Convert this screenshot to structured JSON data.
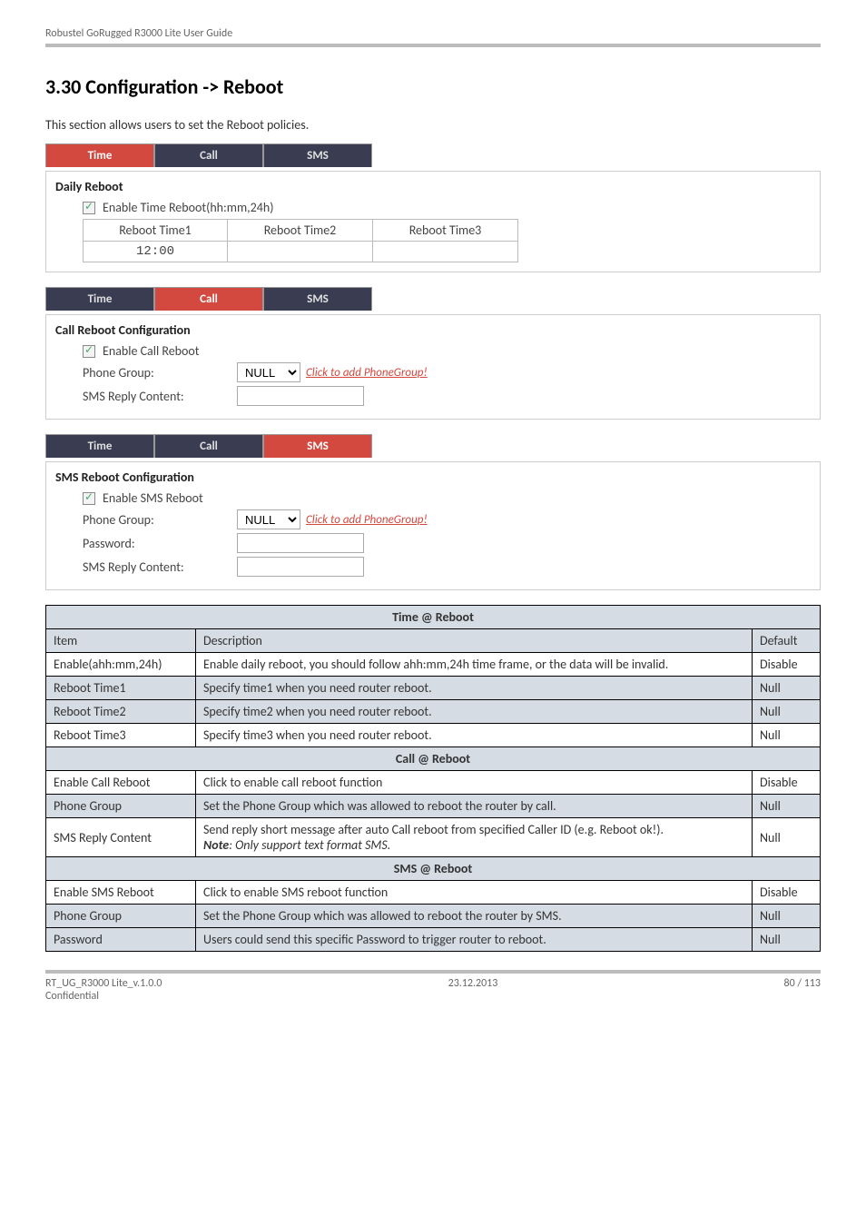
{
  "header": "Robustel GoRugged R3000 Lite User Guide",
  "heading": "3.30  Configuration -> Reboot",
  "intro": "This section allows users to set the Reboot policies.",
  "tabs": {
    "time": "Time",
    "call": "Call",
    "sms": "SMS"
  },
  "daily": {
    "title": "Daily Reboot",
    "enable_label": "Enable Time Reboot(hh:mm,24h)",
    "cols": {
      "t1": "Reboot Time1",
      "t2": "Reboot Time2",
      "t3": "Reboot Time3"
    },
    "vals": {
      "t1": "12:00",
      "t2": "",
      "t3": ""
    }
  },
  "call_cfg": {
    "title": "Call Reboot Configuration",
    "enable_label": "Enable Call Reboot",
    "phone_group_label": "Phone Group:",
    "phone_group_value": "NULL",
    "phone_group_link": "Click to add PhoneGroup!",
    "reply_label": "SMS Reply Content:"
  },
  "sms_cfg": {
    "title": "SMS Reboot Configuration",
    "enable_label": "Enable SMS Reboot",
    "phone_group_label": "Phone Group:",
    "phone_group_value": "NULL",
    "phone_group_link": "Click to add PhoneGroup!",
    "password_label": "Password:",
    "reply_label": "SMS Reply Content:"
  },
  "desc": {
    "time_hdr": "Time @ Reboot",
    "item_hdr": "Item",
    "desc_hdr": "Description",
    "def_hdr": "Default",
    "rows_time": [
      {
        "item": "Enable(ahh:mm,24h)",
        "desc": "Enable daily reboot, you should follow ahh:mm,24h time frame, or the data will be invalid.",
        "def": "Disable"
      },
      {
        "item": "Reboot Time1",
        "desc": "Specify time1 when you need router reboot.",
        "def": "Null"
      },
      {
        "item": "Reboot Time2",
        "desc": "Specify time2 when you need router reboot.",
        "def": "Null"
      },
      {
        "item": "Reboot Time3",
        "desc": "Specify time3 when you need router reboot.",
        "def": "Null"
      }
    ],
    "call_hdr": "Call @ Reboot",
    "rows_call": [
      {
        "item": "Enable Call Reboot",
        "desc": "Click to enable call reboot function",
        "def": "Disable"
      },
      {
        "item": "Phone Group",
        "desc": "Set the Phone Group which was allowed to reboot the router by call.",
        "def": "Null"
      }
    ],
    "sms_reply": {
      "item": "SMS Reply Content",
      "line1": "Send reply short message after auto Call reboot from specified Caller ID (e.g. Reboot ok!).",
      "note_label": "Note",
      "note_rest": ": Only support text format SMS.",
      "def": "Null"
    },
    "sms_hdr": "SMS @ Reboot",
    "rows_sms": [
      {
        "item": "Enable SMS Reboot",
        "desc": "Click to enable SMS reboot function",
        "def": "Disable"
      },
      {
        "item": "Phone Group",
        "desc": "Set the Phone Group which was allowed to reboot the router by SMS.",
        "def": "Null"
      },
      {
        "item": "Password",
        "desc": "Users could send this specific Password to trigger router to reboot.",
        "def": "Null"
      }
    ]
  },
  "footer": {
    "left1": "RT_UG_R3000 Lite_v.1.0.0",
    "left2": "Confidential",
    "center": "23.12.2013",
    "right": "80 / 113"
  }
}
